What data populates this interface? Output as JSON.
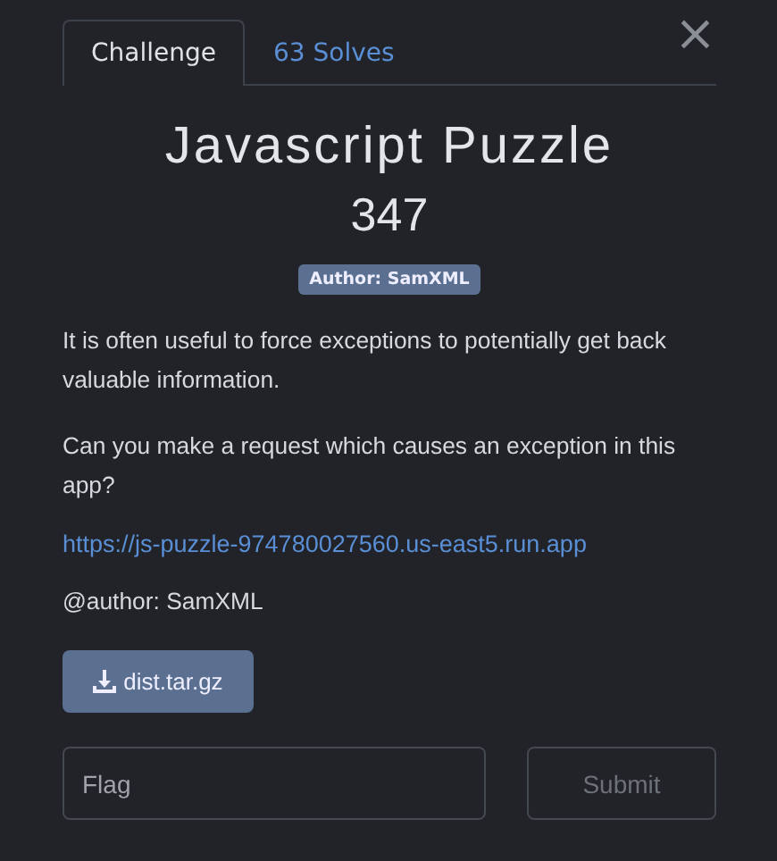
{
  "tabs": [
    {
      "label": "Challenge",
      "selected": true
    },
    {
      "label": "63 Solves",
      "selected": false
    }
  ],
  "close": "×",
  "title": "Javascript Puzzle",
  "points": "347",
  "author_badge": "Author: SamXML",
  "paragraphs": [
    "It is often useful to force exceptions to potentially get back valuable information.",
    "Can you make a request which causes an exception in this app?"
  ],
  "link": "https://js-puzzle-974780027560.us-east5.run.app",
  "author_line": "@author: SamXML",
  "download": {
    "label": "dist.tar.gz"
  },
  "flag": {
    "placeholder": "Flag"
  },
  "submit": {
    "label": "Submit",
    "disabled": true
  }
}
